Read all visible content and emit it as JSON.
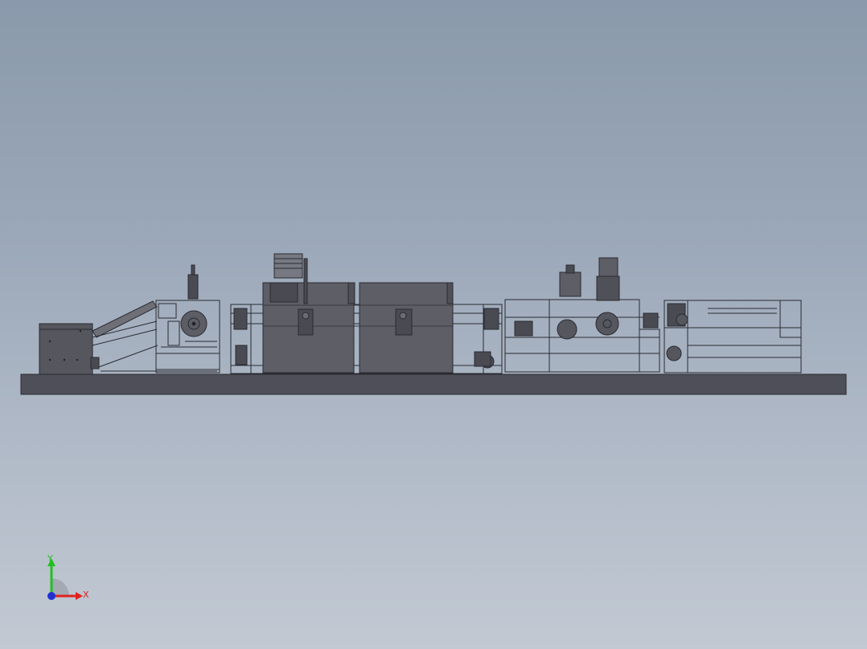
{
  "viewport": {
    "model": "machine-assembly-side-view",
    "colors": {
      "background_top": "#8a99ab",
      "background_bottom": "#c2c9d3",
      "base_plate": "#4e4f58",
      "machine_body": "#5a5b63",
      "frame_line": "#2a2b31",
      "frame_fill": "#6b6c74"
    }
  },
  "triad": {
    "x_label": "X",
    "y_label": "Y",
    "x_color": "#e02020",
    "y_color": "#20c020",
    "z_color": "#2030d0"
  }
}
